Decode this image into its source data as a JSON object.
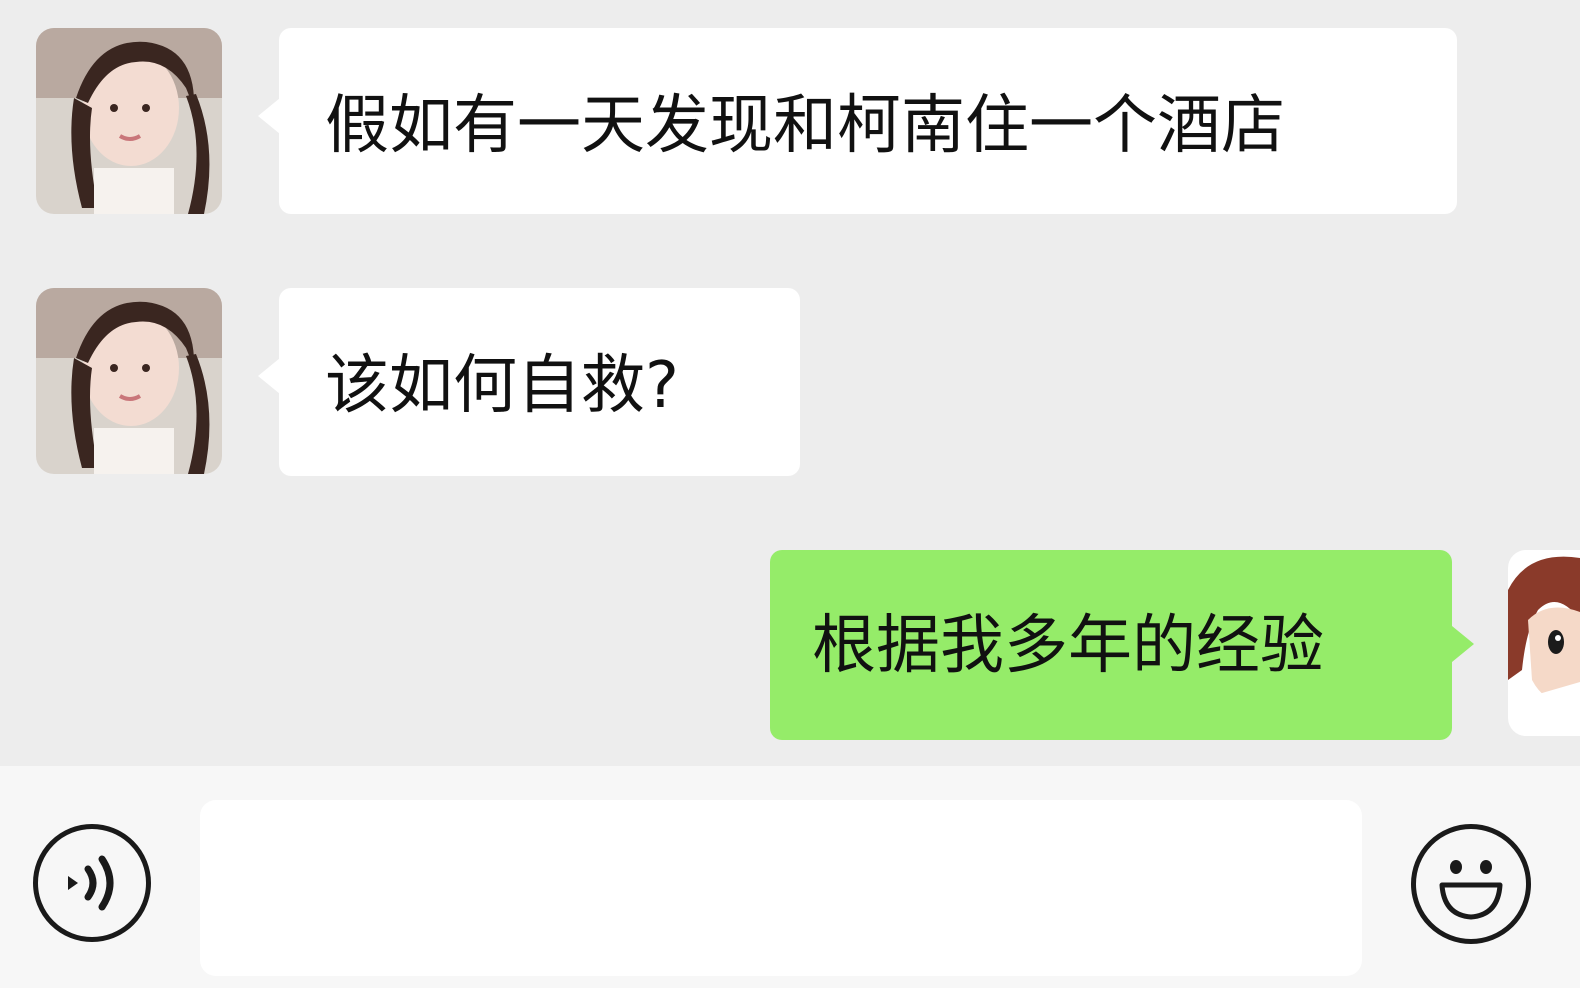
{
  "messages": [
    {
      "side": "incoming",
      "text": "假如有一天发现和柯南住一个酒店"
    },
    {
      "side": "incoming",
      "text": "该如何自救?"
    },
    {
      "side": "outgoing",
      "text": "根据我多年的经验"
    }
  ],
  "input": {
    "value": "",
    "placeholder": ""
  },
  "icons": {
    "voice": "voice-icon",
    "emoji": "emoji-smile-icon"
  },
  "colors": {
    "background": "#ededed",
    "incoming_bubble": "#ffffff",
    "outgoing_bubble": "#95ec69",
    "input_bar": "#f7f7f7"
  }
}
